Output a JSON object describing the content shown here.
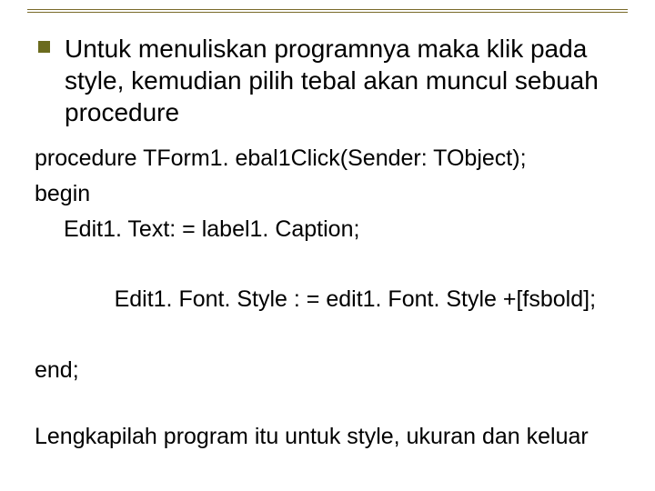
{
  "bullet": {
    "text": "Untuk menuliskan programnya maka klik pada style, kemudian pilih tebal akan muncul sebuah procedure"
  },
  "code": {
    "l1": "procedure TForm1. ebal1Click(Sender: TObject);",
    "l2": "begin",
    "l3": "Edit1. Text: = label1. Caption;",
    "l4_a": "Edit1. Font. Style : = edit1. Font. Style +[fsbold",
    "l4_b": "];",
    "l5": "end;"
  },
  "footer": {
    "text": "Lengkapilah program itu untuk style, ukuran dan keluar"
  }
}
